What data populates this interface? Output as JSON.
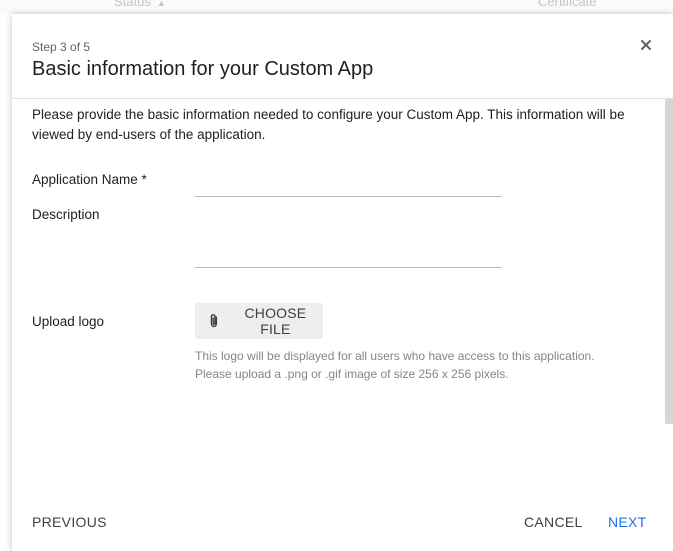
{
  "background": {
    "status_header": "Status",
    "certificate_header": "Certificate"
  },
  "dialog": {
    "step": "Step 3 of 5",
    "title": "Basic information for your Custom App",
    "intro": "Please provide the basic information needed to configure your Custom App. This information will be viewed by end-users of the application.",
    "fields": {
      "name_label": "Application Name *",
      "name_value": "",
      "description_label": "Description",
      "description_value": "",
      "logo_label": "Upload logo"
    },
    "choose_file_label": "CHOOSE FILE",
    "logo_hint": "This logo will be displayed for all users who have access to this application. Please upload a .png or .gif image of size 256 x 256 pixels.",
    "buttons": {
      "previous": "PREVIOUS",
      "cancel": "CANCEL",
      "next": "NEXT"
    }
  },
  "colors": {
    "accent": "#1a73e8",
    "text_primary": "#202124",
    "text_secondary": "#80868b",
    "button_bg": "#eeeeee"
  },
  "icons": {
    "close": "close-icon",
    "attachment": "paperclip-icon",
    "sort": "sort-arrow-icon"
  }
}
